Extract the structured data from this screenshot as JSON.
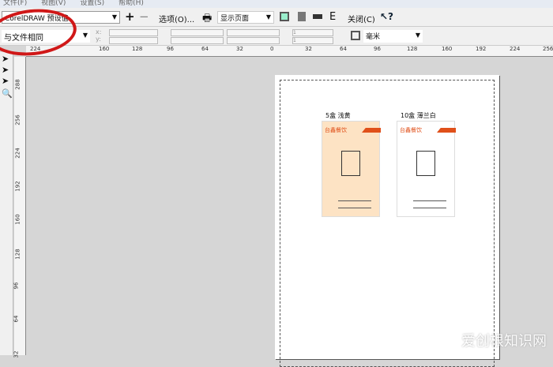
{
  "menu": [
    "文件(F)",
    "视图(V)",
    "设置(S)",
    "帮助(H)"
  ],
  "toolbar1": {
    "preset": "CorelDRAW 预设值",
    "add": "+",
    "remove": "−",
    "options": "选项(O)...",
    "display": "显示页面",
    "e_label": "E",
    "close": "关闭(C)"
  },
  "toolbar2": {
    "page_size": "与文件相同",
    "x_label": "x:",
    "y_label": "y:",
    "copies_a": "1",
    "copies_b": "1",
    "units": "毫米"
  },
  "hruler": [
    "224",
    "160",
    "128",
    "96",
    "64",
    "32",
    "0",
    "32",
    "64",
    "96",
    "128",
    "160",
    "192",
    "224",
    "256"
  ],
  "vruler": [
    "288",
    "256",
    "224",
    "192",
    "160",
    "128",
    "96",
    "64",
    "32"
  ],
  "cards": [
    {
      "caption": "5盒  浅黄",
      "brand": "台鑫餐饮",
      "color": "#fde3c4"
    },
    {
      "caption": "10盒  薄兰白",
      "brand": "台鑫餐饮",
      "color": "#ffffff"
    }
  ],
  "accent": "#e0501a",
  "watermark": "爱创根知识网"
}
